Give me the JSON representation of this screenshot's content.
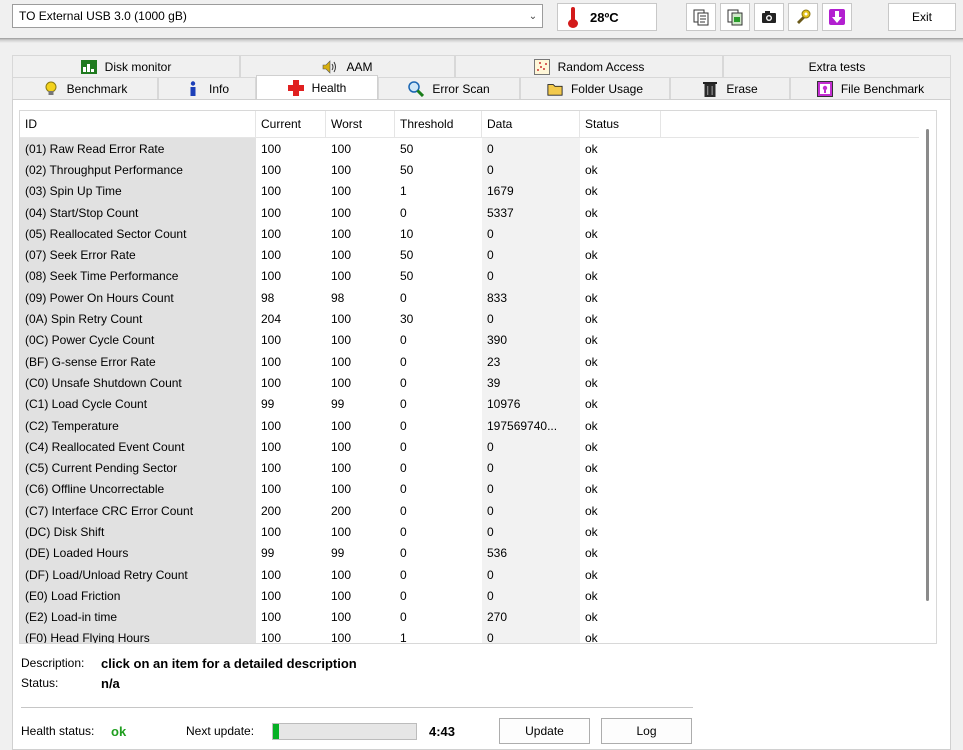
{
  "drive": {
    "selected": "TO External USB 3.0 (1000 gB)"
  },
  "temperature": {
    "value": "28",
    "unit": "ºC"
  },
  "toolbar": {
    "exit_label": "Exit"
  },
  "tabs": {
    "row1": [
      {
        "label": "Disk monitor",
        "icon": "disk-monitor-icon"
      },
      {
        "label": "AAM",
        "icon": "speaker-icon"
      },
      {
        "label": "Random Access",
        "icon": "random-access-icon"
      },
      {
        "label": "Extra tests",
        "icon": ""
      }
    ],
    "row2": [
      {
        "label": "Benchmark",
        "icon": "lightbulb-icon"
      },
      {
        "label": "Info",
        "icon": "info-icon"
      },
      {
        "label": "Health",
        "icon": "health-cross-icon",
        "active": true
      },
      {
        "label": "Error Scan",
        "icon": "magnifier-icon"
      },
      {
        "label": "Folder Usage",
        "icon": "folder-icon"
      },
      {
        "label": "Erase",
        "icon": "trash-icon"
      },
      {
        "label": "File Benchmark",
        "icon": "file-benchmark-icon"
      }
    ]
  },
  "table": {
    "columns": [
      "ID",
      "Current",
      "Worst",
      "Threshold",
      "Data",
      "Status"
    ],
    "rows": [
      [
        "(01) Raw Read Error Rate",
        "100",
        "100",
        "50",
        "0",
        "ok"
      ],
      [
        "(02) Throughput Performance",
        "100",
        "100",
        "50",
        "0",
        "ok"
      ],
      [
        "(03) Spin Up Time",
        "100",
        "100",
        "1",
        "1679",
        "ok"
      ],
      [
        "(04) Start/Stop Count",
        "100",
        "100",
        "0",
        "5337",
        "ok"
      ],
      [
        "(05) Reallocated Sector Count",
        "100",
        "100",
        "10",
        "0",
        "ok"
      ],
      [
        "(07) Seek Error Rate",
        "100",
        "100",
        "50",
        "0",
        "ok"
      ],
      [
        "(08) Seek Time Performance",
        "100",
        "100",
        "50",
        "0",
        "ok"
      ],
      [
        "(09) Power On Hours Count",
        "98",
        "98",
        "0",
        "833",
        "ok"
      ],
      [
        "(0A) Spin Retry Count",
        "204",
        "100",
        "30",
        "0",
        "ok"
      ],
      [
        "(0C) Power Cycle Count",
        "100",
        "100",
        "0",
        "390",
        "ok"
      ],
      [
        "(BF) G-sense Error Rate",
        "100",
        "100",
        "0",
        "23",
        "ok"
      ],
      [
        "(C0) Unsafe Shutdown Count",
        "100",
        "100",
        "0",
        "39",
        "ok"
      ],
      [
        "(C1) Load Cycle Count",
        "99",
        "99",
        "0",
        "10976",
        "ok"
      ],
      [
        "(C2) Temperature",
        "100",
        "100",
        "0",
        "197569740...",
        "ok"
      ],
      [
        "(C4) Reallocated Event Count",
        "100",
        "100",
        "0",
        "0",
        "ok"
      ],
      [
        "(C5) Current Pending Sector",
        "100",
        "100",
        "0",
        "0",
        "ok"
      ],
      [
        "(C6) Offline Uncorrectable",
        "100",
        "100",
        "0",
        "0",
        "ok"
      ],
      [
        "(C7) Interface CRC Error Count",
        "200",
        "200",
        "0",
        "0",
        "ok"
      ],
      [
        "(DC) Disk Shift",
        "100",
        "100",
        "0",
        "0",
        "ok"
      ],
      [
        "(DE) Loaded Hours",
        "99",
        "99",
        "0",
        "536",
        "ok"
      ],
      [
        "(DF) Load/Unload Retry Count",
        "100",
        "100",
        "0",
        "0",
        "ok"
      ],
      [
        "(E0) Load Friction",
        "100",
        "100",
        "0",
        "0",
        "ok"
      ],
      [
        "(E2) Load-in time",
        "100",
        "100",
        "0",
        "270",
        "ok"
      ],
      [
        "(F0) Head Flying Hours",
        "100",
        "100",
        "1",
        "0",
        "ok"
      ]
    ]
  },
  "description": {
    "label": "Description:",
    "value": "click on an item for a detailed description",
    "status_label": "Status:",
    "status_value": "n/a"
  },
  "footer": {
    "health_label": "Health status:",
    "health_value": "ok",
    "next_update_label": "Next update:",
    "progress_fraction": 0.04,
    "countdown": "4:43",
    "update_label": "Update",
    "log_label": "Log"
  },
  "colors": {
    "health_ok": "#1f9e1f",
    "progress": "#06b025",
    "health_icon": "#e02020"
  }
}
